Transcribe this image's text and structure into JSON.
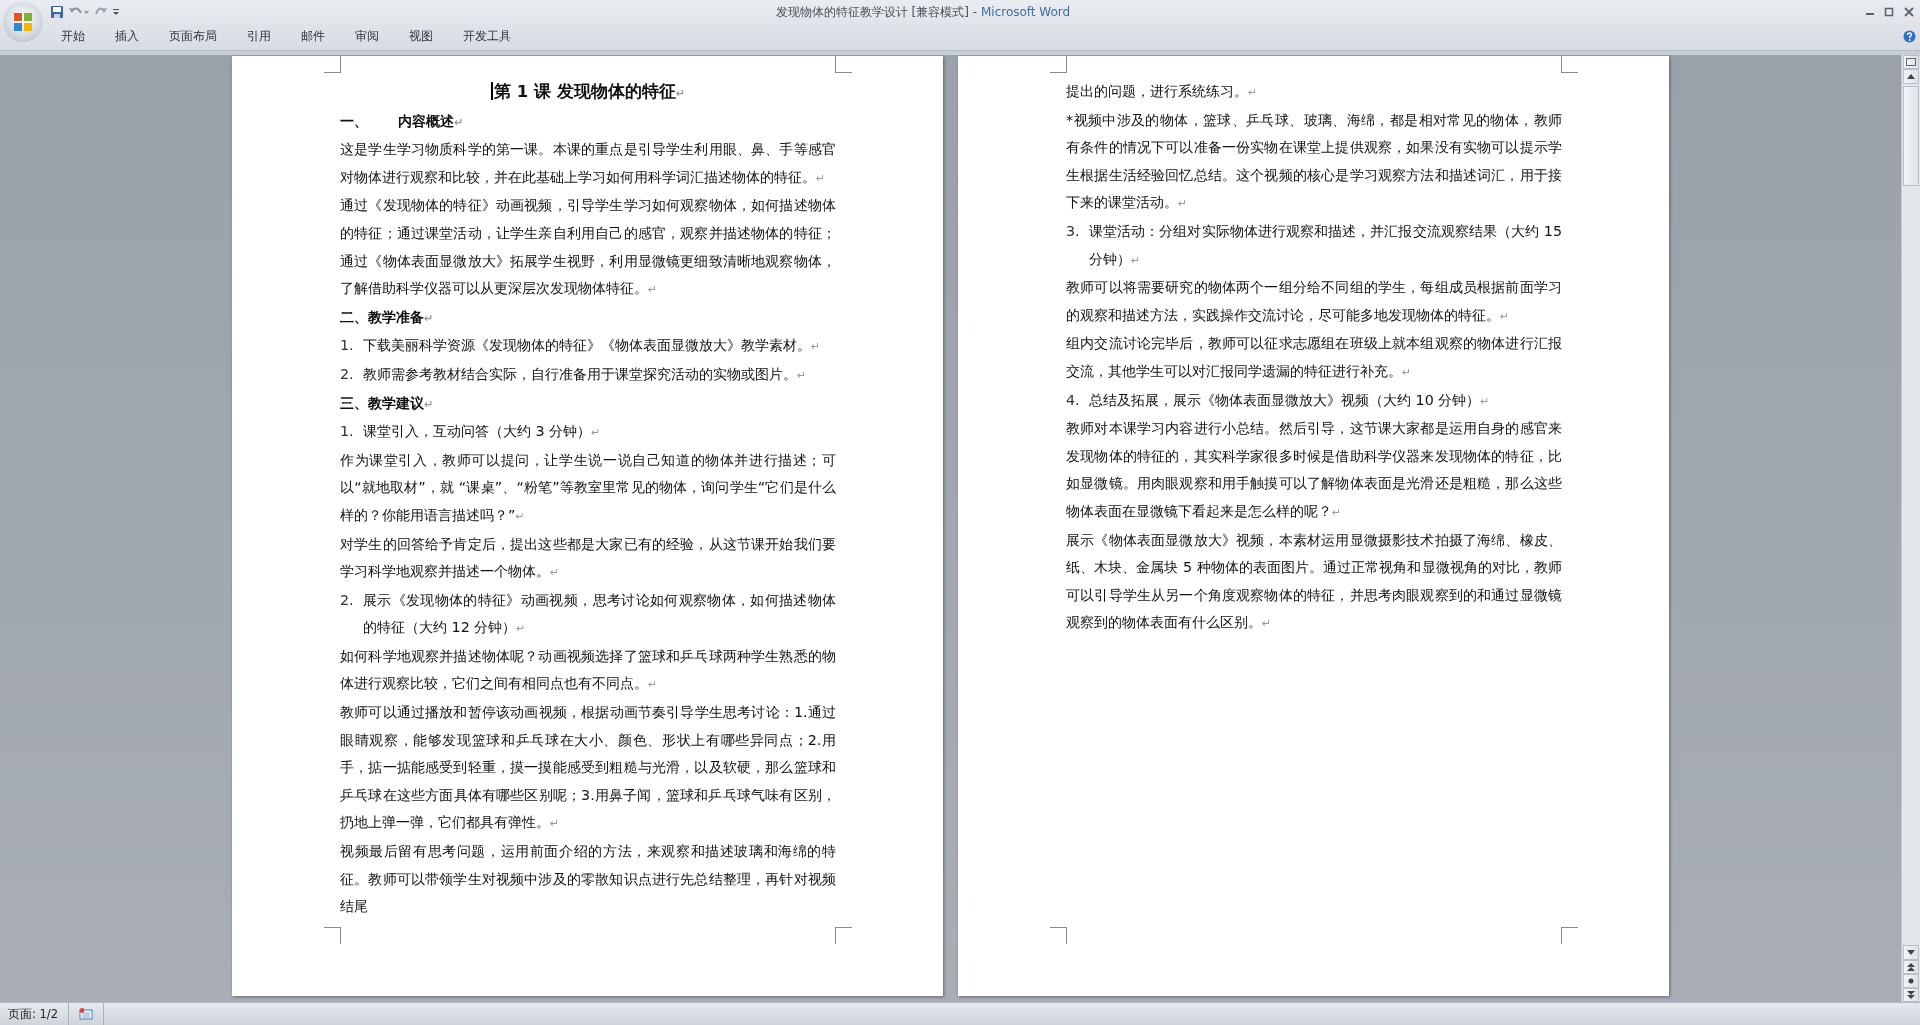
{
  "window": {
    "title": "发现物体的特征教学设计 [兼容模式]",
    "separator": "-",
    "app_name": "Microsoft Word"
  },
  "ribbon_tabs": [
    "开始",
    "插入",
    "页面布局",
    "引用",
    "邮件",
    "审阅",
    "视图",
    "开发工具"
  ],
  "pages": [
    {
      "blocks": [
        {
          "kind": "title",
          "text": "第 1 课  发现物体的特征",
          "mark": "↵",
          "cursor": true
        },
        {
          "kind": "heading",
          "text": "一、      内容概述",
          "mark": "↵"
        },
        {
          "kind": "para",
          "text": "这是学生学习物质科学的第一课。本课的重点是引导学生利用眼、鼻、手等感官对物体进行观察和比较，并在此基础上学习如何用科学词汇描述物体的特征。",
          "mark": "↵"
        },
        {
          "kind": "para",
          "text": "通过《发现物体的特征》动画视频，引导学生学习如何观察物体，如何描述物体的特征；通过课堂活动，让学生亲自利用自己的感官，观察并描述物体的特征；通过《物体表面显微放大》拓展学生视野，利用显微镜更细致清晰地观察物体，了解借助科学仪器可以从更深层次发现物体特征。",
          "mark": "↵"
        },
        {
          "kind": "heading",
          "text": "二、教学准备",
          "mark": "↵"
        },
        {
          "kind": "item",
          "number": "1.",
          "text": "下载美丽科学资源《发现物体的特征》《物体表面显微放大》教学素材。",
          "mark": "↵"
        },
        {
          "kind": "item",
          "number": "2.",
          "text": "教师需参考教材结合实际，自行准备用于课堂探究活动的实物或图片。",
          "mark": "↵"
        },
        {
          "kind": "heading",
          "text": "三、教学建议",
          "mark": "↵"
        },
        {
          "kind": "item",
          "number": "1.",
          "text": "课堂引入，互动问答（大约 3 分钟）",
          "mark": "↵"
        },
        {
          "kind": "para",
          "text": "作为课堂引入，教师可以提问，让学生说一说自己知道的物体并进行描述；可以“就地取材”，就 “课桌”、“粉笔”等教室里常见的物体，询问学生“它们是什么样的？你能用语言描述吗？”",
          "mark": "↵"
        },
        {
          "kind": "para",
          "text": "对学生的回答给予肯定后，提出这些都是大家已有的经验，从这节课开始我们要学习科学地观察并描述一个物体。",
          "mark": "↵"
        },
        {
          "kind": "item",
          "number": "2.",
          "text": "展示《发现物体的特征》动画视频，思考讨论如何观察物体，如何描述物体的特征（大约 12 分钟）",
          "mark": "↵"
        },
        {
          "kind": "para",
          "text": "如何科学地观察并描述物体呢？动画视频选择了篮球和乒乓球两种学生熟悉的物体进行观察比较，它们之间有相同点也有不同点。",
          "mark": "↵"
        },
        {
          "kind": "para",
          "text": "教师可以通过播放和暂停该动画视频，根据动画节奏引导学生思考讨论：1.通过眼睛观察，能够发现篮球和乒乓球在大小、颜色、形状上有哪些异同点；2.用手，掂一掂能感受到轻重，摸一摸能感受到粗糙与光滑，以及软硬，那么篮球和乒乓球在这些方面具体有哪些区别呢；3.用鼻子闻，篮球和乒乓球气味有区别，扔地上弹一弹，它们都具有弹性。",
          "mark": "↵"
        },
        {
          "kind": "para",
          "text": "视频最后留有思考问题，运用前面介绍的方法，来观察和描述玻璃和海绵的特征。教师可以带领学生对视频中涉及的零散知识点进行先总结整理，再针对视频结尾"
        }
      ]
    },
    {
      "blocks": [
        {
          "kind": "para",
          "text": "提出的问题，进行系统练习。",
          "mark": "↵"
        },
        {
          "kind": "para",
          "text": "*视频中涉及的物体，篮球、乒乓球、玻璃、海绵，都是相对常见的物体，教师有条件的情况下可以准备一份实物在课堂上提供观察，如果没有实物可以提示学生根据生活经验回忆总结。这个视频的核心是学习观察方法和描述词汇，用于接下来的课堂活动。",
          "mark": "↵"
        },
        {
          "kind": "item",
          "number": "3.",
          "text": "课堂活动：分组对实际物体进行观察和描述，并汇报交流观察结果（大约 15 分钟）",
          "mark": "↵"
        },
        {
          "kind": "para",
          "text": "教师可以将需要研究的物体两个一组分给不同组的学生，每组成员根据前面学习的观察和描述方法，实践操作交流讨论，尽可能多地发现物体的特征。",
          "mark": "↵"
        },
        {
          "kind": "para",
          "text": "组内交流讨论完毕后，教师可以征求志愿组在班级上就本组观察的物体进行汇报交流，其他学生可以对汇报同学遗漏的特征进行补充。",
          "mark": "↵"
        },
        {
          "kind": "item",
          "number": "4.",
          "text": "总结及拓展，展示《物体表面显微放大》视频（大约 10 分钟）",
          "mark": "↵"
        },
        {
          "kind": "para",
          "text": "教师对本课学习内容进行小总结。然后引导，这节课大家都是运用自身的感官来发现物体的特征的，其实科学家很多时候是借助科学仪器来发现物体的特征，比如显微镜。用肉眼观察和用手触摸可以了解物体表面是光滑还是粗糙，那么这些物体表面在显微镜下看起来是怎么样的呢？",
          "mark": "↵"
        },
        {
          "kind": "para",
          "text": "展示《物体表面显微放大》视频，本素材运用显微摄影技术拍摄了海绵、橡皮、纸、木块、金属块 5 种物体的表面图片。通过正常视角和显微视角的对比，教师可以引导学生从另一个角度观察物体的特征，并思考肉眼观察到的和通过显微镜观察到的物体表面有什么区别。",
          "mark": "↵"
        }
      ]
    }
  ],
  "status_bar": {
    "page": "页面: 1/2"
  }
}
